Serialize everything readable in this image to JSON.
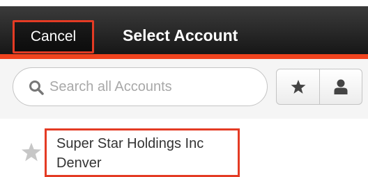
{
  "header": {
    "cancel_label": "Cancel",
    "title": "Select Account"
  },
  "search": {
    "placeholder": "Search all Accounts",
    "value": "",
    "icon": "search-icon"
  },
  "filters": [
    {
      "icon": "star-icon"
    },
    {
      "icon": "user-icon"
    }
  ],
  "accounts": [
    {
      "name": "Super Star Holdings Inc",
      "city": "Denver",
      "favorite_icon": "star-icon"
    }
  ],
  "colors": {
    "header_bg": "#222222",
    "accent": "#f0431e",
    "highlight": "#e43b24",
    "icon": "#444444"
  }
}
